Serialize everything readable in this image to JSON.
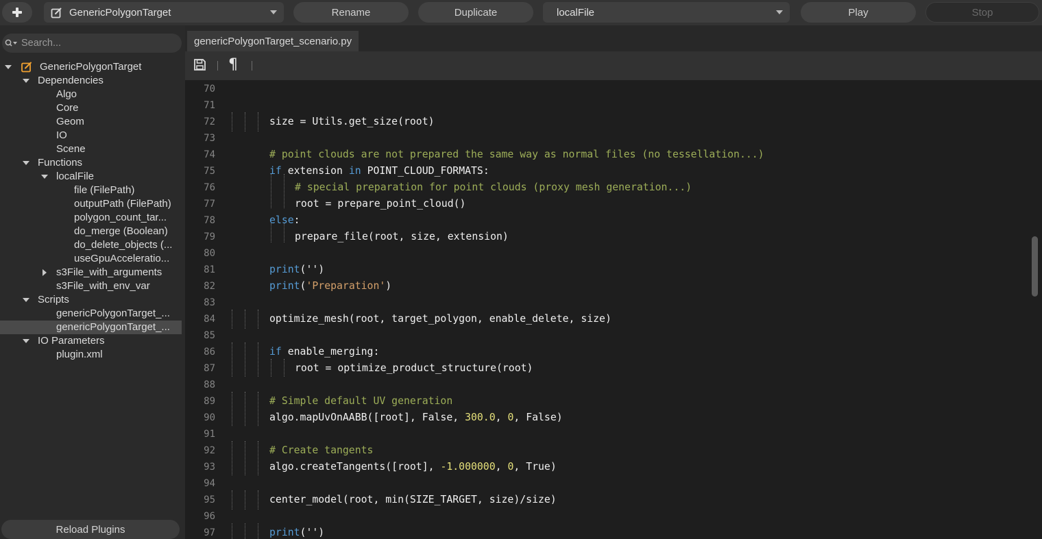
{
  "toolbar": {
    "plugin_name": "GenericPolygonTarget",
    "rename_label": "Rename",
    "duplicate_label": "Duplicate",
    "function_name": "localFile",
    "play_label": "Play",
    "stop_label": "Stop"
  },
  "sidebar": {
    "search_placeholder": "Search...",
    "reload_label": "Reload Plugins",
    "root_label": "GenericPolygonTarget",
    "dependencies_label": "Dependencies",
    "dependencies": [
      "Algo",
      "Core",
      "Geom",
      "IO",
      "Scene"
    ],
    "functions_label": "Functions",
    "localfile_label": "localFile",
    "localfile_params": [
      "file (FilePath)",
      "outputPath (FilePath)",
      "polygon_count_tar...",
      "do_merge (Boolean)",
      "do_delete_objects (...",
      "useGpuAcceleratio..."
    ],
    "s3_with_args_label": "s3File_with_arguments",
    "s3_with_env_label": "s3File_with_env_var",
    "scripts_label": "Scripts",
    "scripts": [
      "genericPolygonTarget_...",
      "genericPolygonTarget_..."
    ],
    "io_params_label": "IO Parameters",
    "io_params": [
      "plugin.xml"
    ]
  },
  "editor": {
    "tab_label": "genericPolygonTarget_scenario.py",
    "line_numbers": [
      "70",
      "71",
      "72",
      "73",
      "74",
      "75",
      "76",
      "77",
      "78",
      "79",
      "80",
      "81",
      "82",
      "83",
      "84",
      "85",
      "86",
      "87",
      "88",
      "89",
      "90",
      "91",
      "92",
      "93",
      "94",
      "95",
      "96",
      "97"
    ],
    "code": {
      "l72": "size = Utils.get_size(root)",
      "l74": "# point clouds are not prepared the same way as normal files (no tessellation...)",
      "l75_kw1": "if",
      "l75_a": " extension ",
      "l75_kw2": "in",
      "l75_b": " POINT_CLOUD_FORMATS:",
      "l76": "# special preparation for point clouds (proxy mesh generation...)",
      "l77": "root = prepare_point_cloud()",
      "l78_kw": "else",
      "l78_rest": ":",
      "l79": "prepare_file(root, size, extension)",
      "l81_kw": "print",
      "l81_rest": "('')",
      "l82_kw": "print",
      "l82_a": "(",
      "l82_str": "'Preparation'",
      "l82_b": ")",
      "l84": "optimize_mesh(root, target_polygon, enable_delete, size)",
      "l86_kw": "if",
      "l86_rest": " enable_merging:",
      "l87": "root = optimize_product_structure(root)",
      "l89": "# Simple default UV generation",
      "l90_a": "algo.mapUvOnAABB([root], False, ",
      "l90_n1": "300.0",
      "l90_b": ", ",
      "l90_n2": "0",
      "l90_c": ", False)",
      "l92": "# Create tangents",
      "l93_a": "algo.createTangents([root], ",
      "l93_n1": "-1.000000",
      "l93_b": ", ",
      "l93_n2": "0",
      "l93_c": ", True)",
      "l95": "center_model(root, min(SIZE_TARGET, size)/size)",
      "l97_kw": "print",
      "l97_rest": "('')"
    }
  },
  "icons": [
    "plus-icon",
    "edit-icon",
    "chevron-down-icon",
    "search-icon",
    "save-icon",
    "pilcrow-icon"
  ]
}
